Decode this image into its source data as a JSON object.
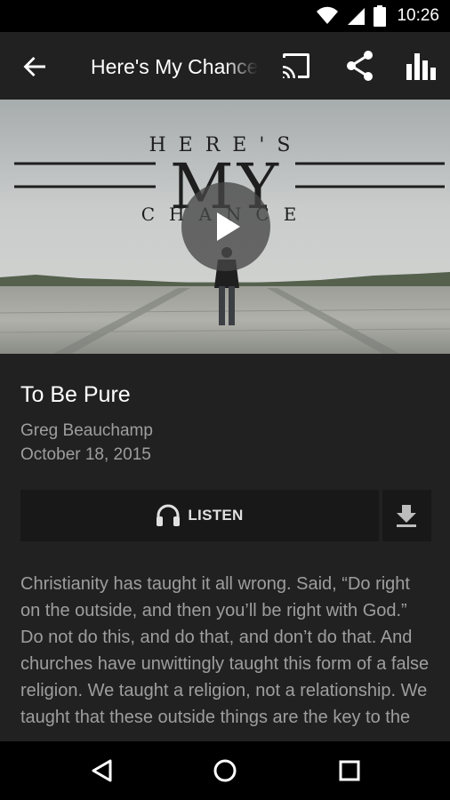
{
  "status_bar": {
    "time": "10:26",
    "icons": [
      "wifi-icon",
      "cell-signal-icon",
      "battery-icon"
    ]
  },
  "app_bar": {
    "title": "Here's My Chance",
    "actions": [
      "cast-icon",
      "share-icon",
      "equalizer-icon"
    ]
  },
  "hero": {
    "series_art_text": {
      "line1": "HERE'S",
      "line2": "MY",
      "line3": "CHANCE"
    },
    "play_icon": "play-icon"
  },
  "sermon": {
    "title": "To Be Pure",
    "speaker": "Greg Beauchamp",
    "date": "October 18, 2015"
  },
  "actions": {
    "listen_label": "LISTEN",
    "listen_icon": "headphones-icon",
    "download_icon": "download-icon"
  },
  "description": "Christianity has taught it all wrong.  Said, “Do right on the outside, and then you’ll be right with God.”  Do not do this, and do that, and don’t do that. And churches have unwittingly taught this form of a false religion.  We taught a religion, not a relationship.  We taught that these outside things are the key to the",
  "colors": {
    "background": "#212121",
    "button_bg": "#181818",
    "secondary_text": "#9e9e9e"
  },
  "nav_bar": {
    "buttons": [
      "back-nav-icon",
      "home-nav-icon",
      "recents-nav-icon"
    ]
  }
}
